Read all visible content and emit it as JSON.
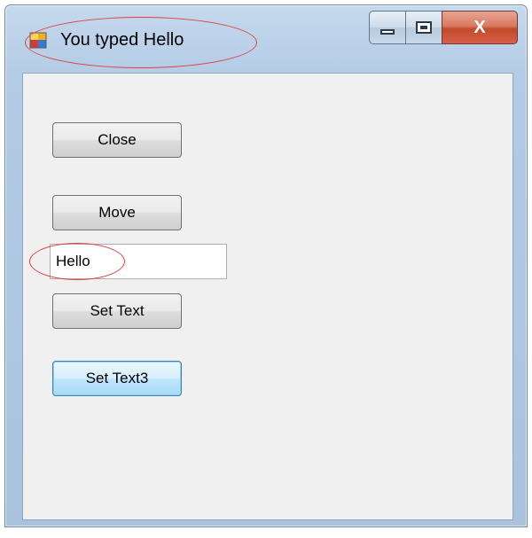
{
  "window": {
    "title": "You typed Hello",
    "app_icon": "winforms-app-icon",
    "caption_buttons": {
      "minimize": "minimize-icon",
      "maximize": "maximize-icon",
      "close_label": "X"
    }
  },
  "form": {
    "close_button_label": "Close",
    "move_button_label": "Move",
    "text_input_value": "Hello",
    "set_text_button_label": "Set Text",
    "set_text3_button_label": "Set Text3"
  },
  "annotations": {
    "highlight_color": "#e04040"
  },
  "colors": {
    "title_bar": "#b3cbe5",
    "close_button": "#c24a2a",
    "client_area": "#f0f0f0",
    "focused_button_border": "#3c7fb1"
  }
}
